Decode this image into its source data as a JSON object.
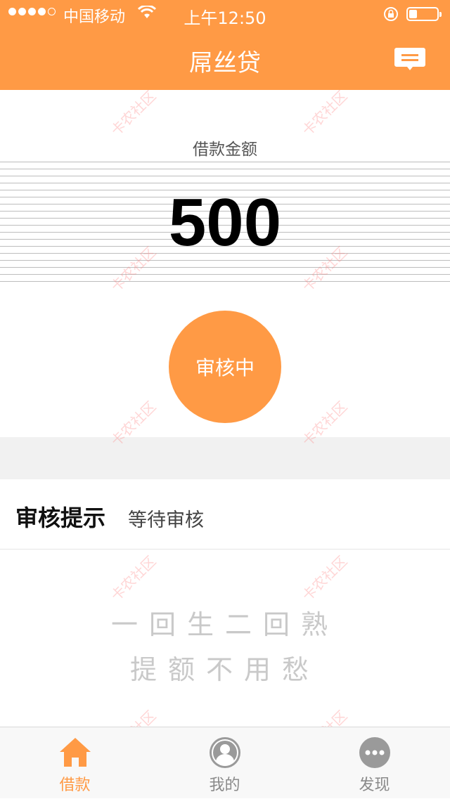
{
  "status_bar": {
    "carrier": "中国移动",
    "time": "上午12:50",
    "battery_level": 0.3
  },
  "nav": {
    "title": "屌丝贷",
    "message_icon": "message-icon"
  },
  "loan": {
    "amount_label": "借款金额",
    "amount": "500",
    "status": "审核中"
  },
  "review": {
    "title": "审核提示",
    "status": "等待审核"
  },
  "slogan": {
    "line1": "一回生二回熟",
    "line2": "提额不用愁"
  },
  "watermark": "卡农社区",
  "tabbar": {
    "items": [
      {
        "label": "借款",
        "icon": "home-icon",
        "active": true
      },
      {
        "label": "我的",
        "icon": "profile-icon",
        "active": false
      },
      {
        "label": "发现",
        "icon": "more-icon",
        "active": false
      }
    ]
  },
  "colors": {
    "accent": "#FF9A45",
    "inactive": "#8a8a8a"
  }
}
